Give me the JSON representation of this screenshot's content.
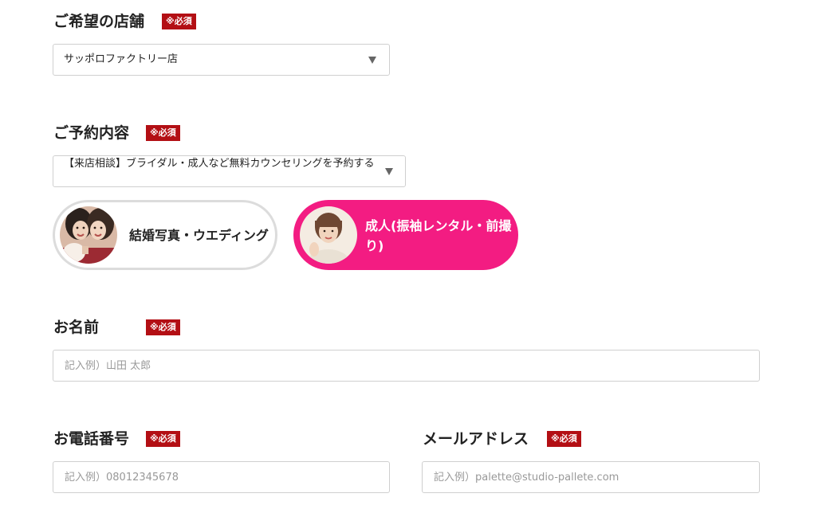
{
  "required_badge": "※必須",
  "store": {
    "label": "ご希望の店舗",
    "selected": "サッポロファクトリー店"
  },
  "reservation": {
    "label": "ご予約内容",
    "selected": "【来店相談】ブライダル・成人など無料カウンセリングを予約する"
  },
  "categories": [
    {
      "label": "結婚写真・ウエディング",
      "selected": false
    },
    {
      "label": "成人(振袖レンタル・前撮り)",
      "selected": true
    }
  ],
  "name": {
    "label": "お名前",
    "placeholder": "記入例）山田 太郎"
  },
  "phone": {
    "label": "お電話番号",
    "placeholder": "記入例）08012345678"
  },
  "email": {
    "label": "メールアドレス",
    "placeholder": "記入例）palette@studio-pallete.com"
  },
  "colors": {
    "required_badge": "#b30f14",
    "selected_pill": "#f31c82",
    "unselected_pill_border": "#dcdcdc"
  }
}
